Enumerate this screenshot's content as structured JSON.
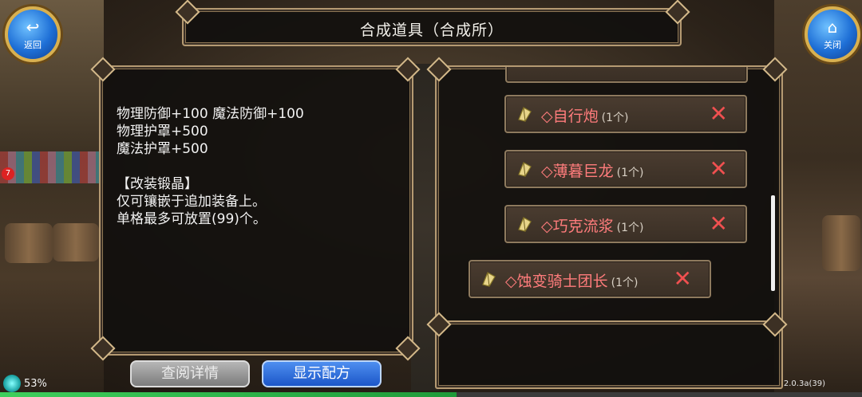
{
  "header": {
    "title": "合成道具（合成所）"
  },
  "nav": {
    "back_label": "返回",
    "close_label": "关闭"
  },
  "description": {
    "text": "物理防御+100 魔法防御+100\n物理护罩+500\n魔法护罩+500\n\n【改装锻晶】\n仅可镶嵌于追加装备上。\n单格最多可放置(99)个。"
  },
  "materials": [
    {
      "name": "◇自行炮",
      "count": "(1个)"
    },
    {
      "name": "◇薄暮巨龙",
      "count": "(1个)"
    },
    {
      "name": "◇巧克流浆",
      "count": "(1个)"
    },
    {
      "name": "◇蚀变骑士团长",
      "count": "(1个)"
    }
  ],
  "buttons": {
    "detail_label": "查阅详情",
    "recipe_label": "显示配方"
  },
  "status": {
    "loading_percent": "53%",
    "progress_fraction": 0.53,
    "version": "2.0.3a(39)",
    "notification_badge": "7"
  },
  "colors": {
    "material_name": "#ff7c7c",
    "remove_icon": "#f05050",
    "recipe_button": "#1c56c8",
    "detail_button": "#7c7c7c",
    "progress": "#3ecf5c"
  }
}
